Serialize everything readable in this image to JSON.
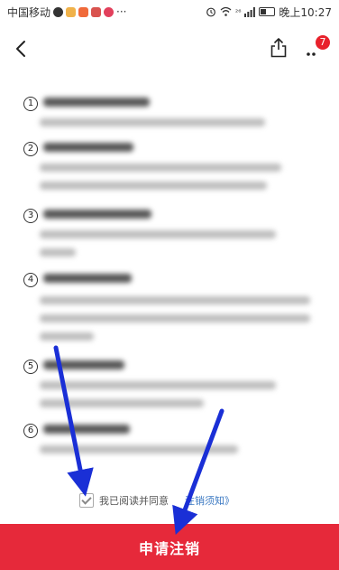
{
  "status_bar": {
    "carrier": "中国移动",
    "more": "···",
    "network": "²⁶",
    "time": "晚上10:27"
  },
  "nav": {
    "badge_count": "7"
  },
  "sections": [
    {
      "number": "1"
    },
    {
      "number": "2"
    },
    {
      "number": "3"
    },
    {
      "number": "4"
    },
    {
      "number": "5"
    },
    {
      "number": "6"
    }
  ],
  "agreement": {
    "prefix": "我已阅读并同意",
    "link": "注销须知》",
    "checked": true
  },
  "submit_button": {
    "label": "申请注销"
  },
  "colors": {
    "primary_red": "#e6293a",
    "badge_red": "#e8212b",
    "arrow_blue": "#1a2fd6",
    "link_blue": "#3a78c2"
  }
}
